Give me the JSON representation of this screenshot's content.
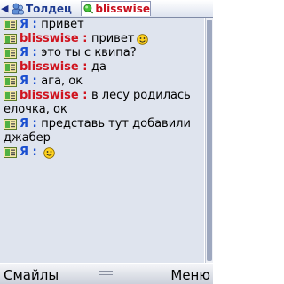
{
  "tabs": [
    {
      "label": "Толдец",
      "icon": "contact-icon",
      "active": false
    },
    {
      "label": "blisswise",
      "icon": "online-status-icon",
      "active": true
    }
  ],
  "messages": [
    {
      "nick": "Я",
      "sender": "me",
      "lines": [
        "привет"
      ],
      "smile": false
    },
    {
      "nick": "blisswise",
      "sender": "peer",
      "lines": [
        "привет"
      ],
      "smile": true
    },
    {
      "nick": "Я",
      "sender": "me",
      "lines": [
        "это ты с квипа?"
      ],
      "smile": false
    },
    {
      "nick": "blisswise",
      "sender": "peer",
      "lines": [
        "да"
      ],
      "smile": false
    },
    {
      "nick": "Я",
      "sender": "me",
      "lines": [
        "ага, ок"
      ],
      "smile": false
    },
    {
      "nick": "blisswise",
      "sender": "peer",
      "lines": [
        "в лесу родилась",
        "елочка, ок"
      ],
      "smile": false
    },
    {
      "nick": "Я",
      "sender": "me",
      "lines": [
        "представь тут добавили",
        "джабер"
      ],
      "smile": false
    },
    {
      "nick": "Я",
      "sender": "me",
      "lines": [
        ""
      ],
      "smile": true
    }
  ],
  "separator": " : ",
  "softkeys": {
    "left": "Смайлы",
    "right": "Меню"
  },
  "colors": {
    "me": "#1a4fd0",
    "peer": "#d0141f",
    "chat_bg": "#dfe4ee"
  }
}
